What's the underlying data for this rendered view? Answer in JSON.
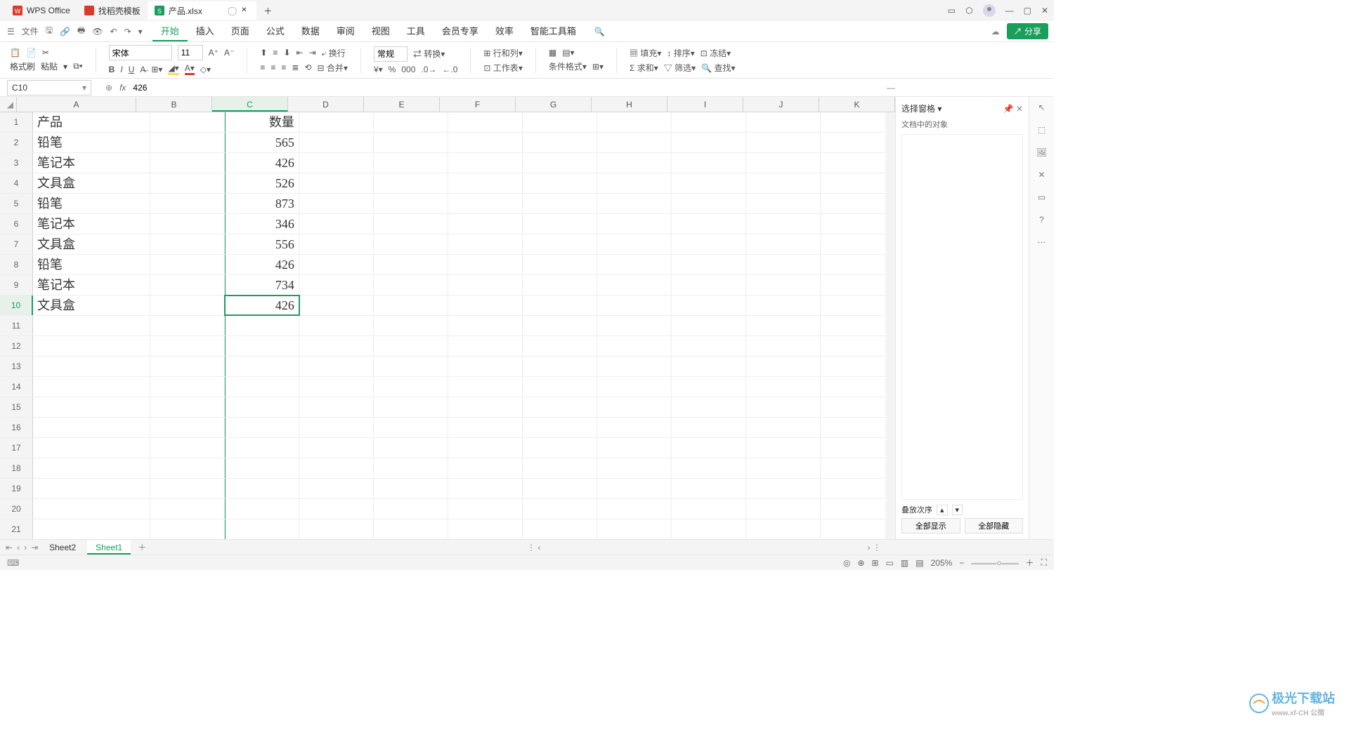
{
  "tabs": [
    {
      "label": "WPS Office",
      "has_icon": true
    },
    {
      "label": "找稻壳模板",
      "has_icon": true
    },
    {
      "label": "产品.xlsx",
      "has_icon": true,
      "active": true
    }
  ],
  "file_menu": "文件",
  "menu": [
    "开始",
    "插入",
    "页面",
    "公式",
    "数据",
    "审阅",
    "视图",
    "工具",
    "会员专享",
    "效率",
    "智能工具箱"
  ],
  "active_menu": 0,
  "ribbon": {
    "format_painter": "格式刷",
    "paste": "粘贴",
    "font_name": "宋体",
    "font_size": "11",
    "wrap": "换行",
    "merge": "合并",
    "number_format": "常规",
    "convert": "转换",
    "row_col": "行和列",
    "worksheet": "工作表",
    "cond_format": "条件格式",
    "fill": "填充",
    "sort": "排序",
    "freeze": "冻结",
    "sum": "求和",
    "filter": "筛选",
    "find": "查找"
  },
  "namebox": "C10",
  "formula_value": "426",
  "columns": [
    "A",
    "B",
    "C",
    "D",
    "E",
    "F",
    "G",
    "H",
    "I",
    "J",
    "K"
  ],
  "selected_col": 2,
  "selected_row": 10,
  "row_count": 21,
  "cells": {
    "A1": "产品",
    "C1": "数量",
    "A2": "铅笔",
    "C2": "565",
    "A3": "笔记本",
    "C3": "426",
    "A4": "文具盒",
    "C4": "526",
    "A5": "铅笔",
    "C5": "873",
    "A6": "笔记本",
    "C6": "346",
    "A7": "文具盒",
    "C7": "556",
    "A8": "铅笔",
    "C8": "426",
    "A9": "笔记本",
    "C9": "734",
    "A10": "文具盒",
    "C10": "426"
  },
  "side_pane": {
    "title": "选择窗格",
    "sub": "文档中的对象",
    "order": "叠放次序",
    "show_all": "全部显示",
    "hide_all": "全部隐藏"
  },
  "sheets": [
    "Sheet2",
    "Sheet1"
  ],
  "active_sheet": 1,
  "zoom": "205%",
  "share": "分享",
  "watermark": "极光下载站",
  "watermark_sub": "www.xf-CH 公简"
}
